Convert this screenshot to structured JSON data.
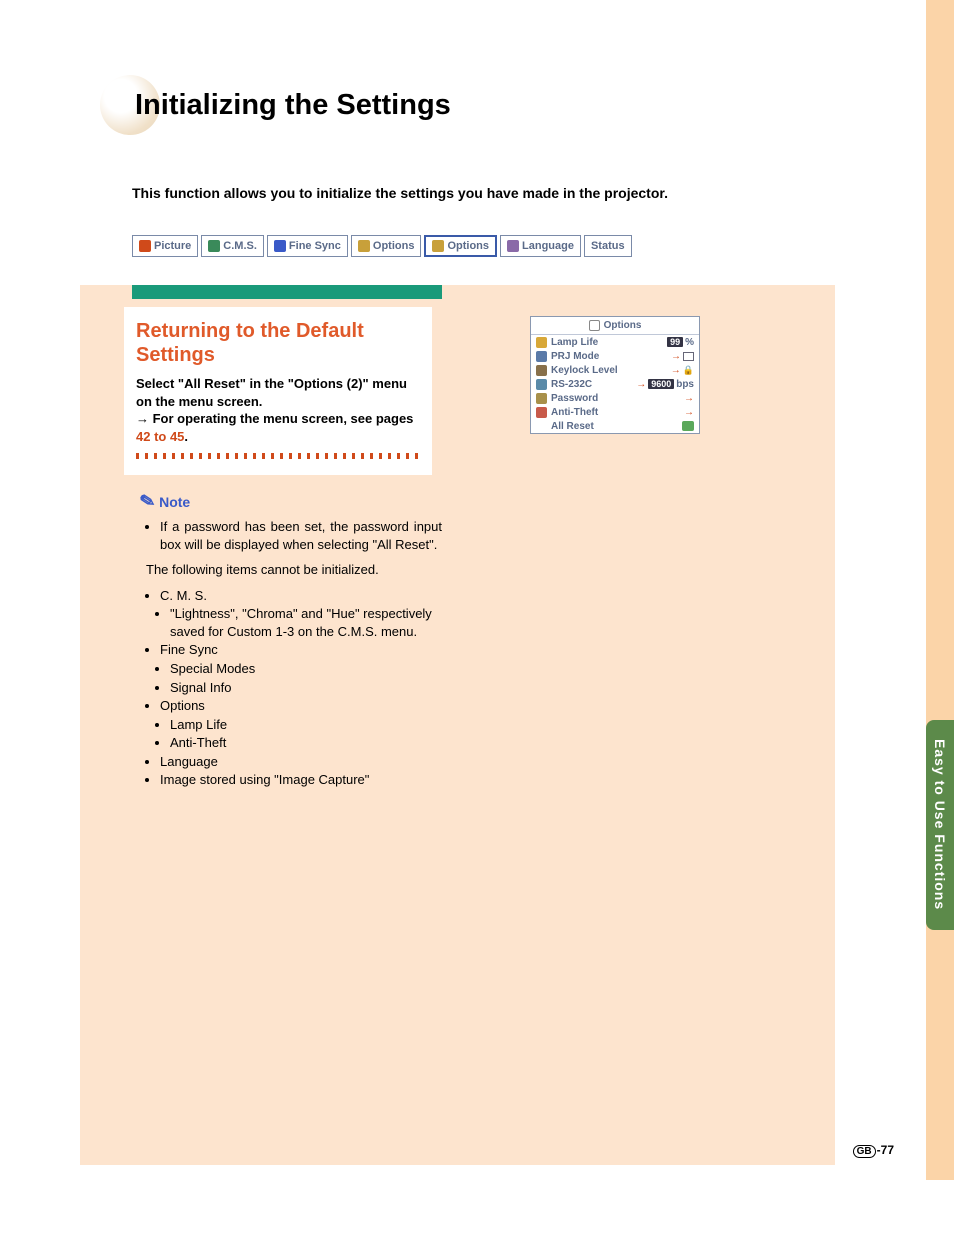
{
  "title": "Initializing the Settings",
  "intro": "This function allows you to initialize the settings you have made in the projector.",
  "tabs": [
    {
      "label": "Picture",
      "color": "#d04a1a"
    },
    {
      "label": "C.M.S.",
      "color": "#3a8a5a"
    },
    {
      "label": "Fine Sync",
      "color": "#3a5ac8"
    },
    {
      "label": "Options",
      "color": "#c8a03a"
    },
    {
      "label": "Options",
      "color": "#c8a03a",
      "selected": true
    },
    {
      "label": "Language",
      "color": "#8a6aa8"
    },
    {
      "label": "Status",
      "color": ""
    }
  ],
  "section_title": "Returning to the Default Settings",
  "instruction_line1": "Select \"All Reset\" in the \"Options (2)\" menu on the menu screen.",
  "instruction_line2_prefix": "→ For operating the menu screen, see pages ",
  "instruction_link": "42 to 45",
  "instruction_suffix": ".",
  "note_label": "Note",
  "note_bullet": "If a password has been set, the password input box will be displayed when selecting \"All Reset\".",
  "cannot_init_intro": "The following items cannot be initialized.",
  "cannot_init": {
    "cms": "C. M. S.",
    "cms_sub": "\"Lightness\", \"Chroma\" and \"Hue\" respectively saved for Custom 1-3 on the C.M.S. menu.",
    "finesync": "Fine Sync",
    "fs_sub1": "Special Modes",
    "fs_sub2": "Signal Info",
    "options": "Options",
    "op_sub1": "Lamp Life",
    "op_sub2": "Anti-Theft",
    "language": "Language",
    "image": "Image stored using \"Image Capture\""
  },
  "options_panel": {
    "header": "Options",
    "rows": [
      {
        "label": "Lamp Life",
        "value_black": "99",
        "suffix": "%"
      },
      {
        "label": "PRJ Mode",
        "arrow": true,
        "icon_end": "box"
      },
      {
        "label": "Keylock Level",
        "arrow": true,
        "icon_end": "lock"
      },
      {
        "label": "RS-232C",
        "arrow": true,
        "value_black": "9600",
        "suffix": "bps"
      },
      {
        "label": "Password",
        "arrow": true
      },
      {
        "label": "Anti-Theft",
        "arrow": true
      },
      {
        "label": "All Reset",
        "green_end": true
      }
    ]
  },
  "side_tab": "Easy to Use Functions",
  "page_region": "GB",
  "page_num": "-77"
}
